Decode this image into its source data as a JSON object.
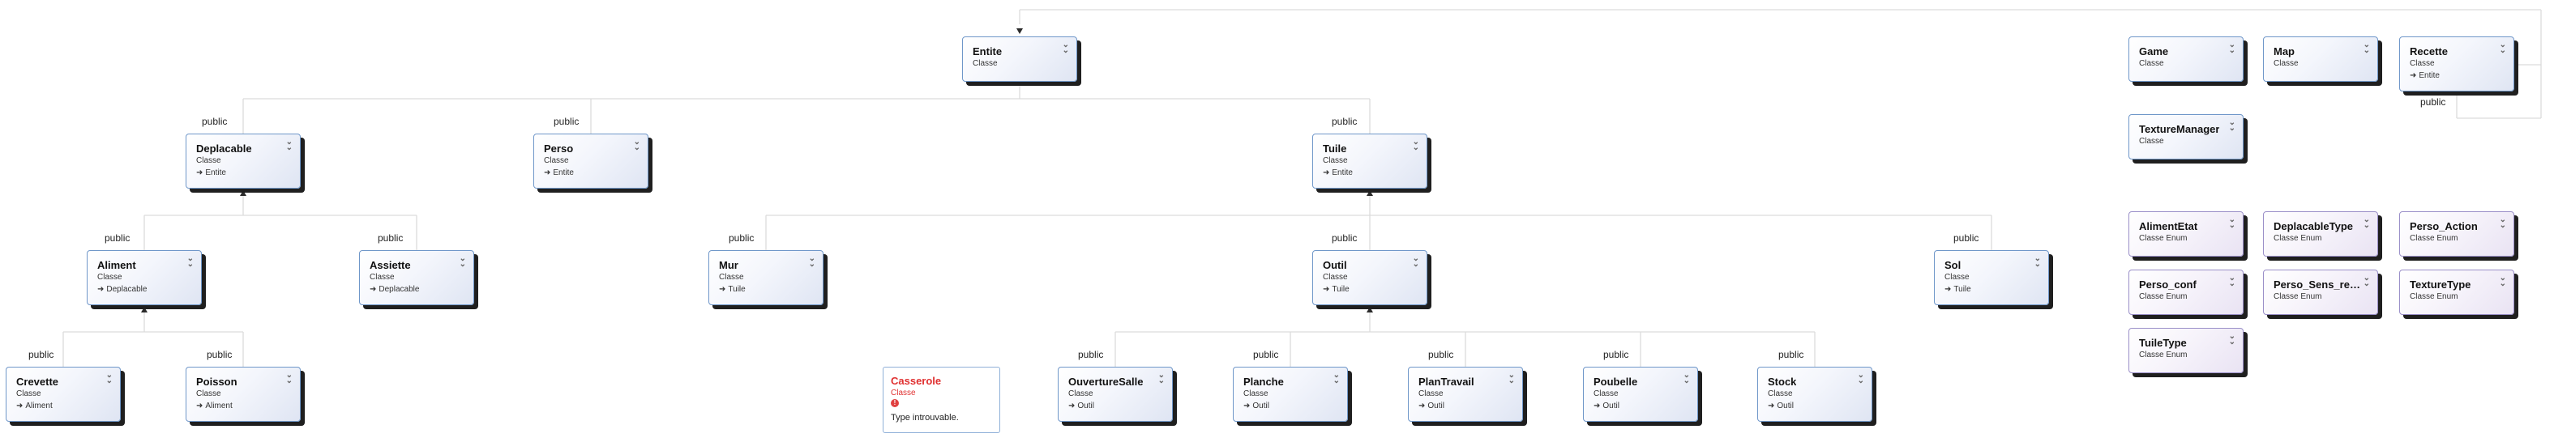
{
  "edge_label": "public",
  "classes": {
    "entite": {
      "name": "Entite",
      "kind": "Classe"
    },
    "deplacable": {
      "name": "Deplacable",
      "kind": "Classe",
      "base": "Entite"
    },
    "perso": {
      "name": "Perso",
      "kind": "Classe",
      "base": "Entite"
    },
    "tuile": {
      "name": "Tuile",
      "kind": "Classe",
      "base": "Entite"
    },
    "aliment": {
      "name": "Aliment",
      "kind": "Classe",
      "base": "Deplacable"
    },
    "assiette": {
      "name": "Assiette",
      "kind": "Classe",
      "base": "Deplacable"
    },
    "mur": {
      "name": "Mur",
      "kind": "Classe",
      "base": "Tuile"
    },
    "outil": {
      "name": "Outil",
      "kind": "Classe",
      "base": "Tuile"
    },
    "sol": {
      "name": "Sol",
      "kind": "Classe",
      "base": "Tuile"
    },
    "crevette": {
      "name": "Crevette",
      "kind": "Classe",
      "base": "Aliment"
    },
    "poisson": {
      "name": "Poisson",
      "kind": "Classe",
      "base": "Aliment"
    },
    "ouverturesalle": {
      "name": "OuvertureSalle",
      "kind": "Classe",
      "base": "Outil"
    },
    "planche": {
      "name": "Planche",
      "kind": "Classe",
      "base": "Outil"
    },
    "plantravail": {
      "name": "PlanTravail",
      "kind": "Classe",
      "base": "Outil"
    },
    "poubelle": {
      "name": "Poubelle",
      "kind": "Classe",
      "base": "Outil"
    },
    "stock": {
      "name": "Stock",
      "kind": "Classe",
      "base": "Outil"
    },
    "game": {
      "name": "Game",
      "kind": "Classe"
    },
    "map": {
      "name": "Map",
      "kind": "Classe"
    },
    "recette": {
      "name": "Recette",
      "kind": "Classe",
      "base": "Entite"
    },
    "texturemanager": {
      "name": "TextureManager",
      "kind": "Classe"
    }
  },
  "enums": {
    "alimentetat": {
      "name": "AlimentEtat",
      "kind": "Classe Enum"
    },
    "deplacabletype": {
      "name": "DeplacableType",
      "kind": "Classe Enum"
    },
    "persoaction": {
      "name": "Perso_Action",
      "kind": "Classe Enum"
    },
    "persoconf": {
      "name": "Perso_conf",
      "kind": "Classe Enum"
    },
    "persosens": {
      "name": "Perso_Sens_rega...",
      "kind": "Classe Enum"
    },
    "texturetype": {
      "name": "TextureType",
      "kind": "Classe Enum"
    },
    "tuiletype": {
      "name": "TuileType",
      "kind": "Classe Enum"
    }
  },
  "missing": {
    "casserole": {
      "name": "Casserole",
      "kind": "Classe",
      "message": "Type introuvable."
    }
  }
}
